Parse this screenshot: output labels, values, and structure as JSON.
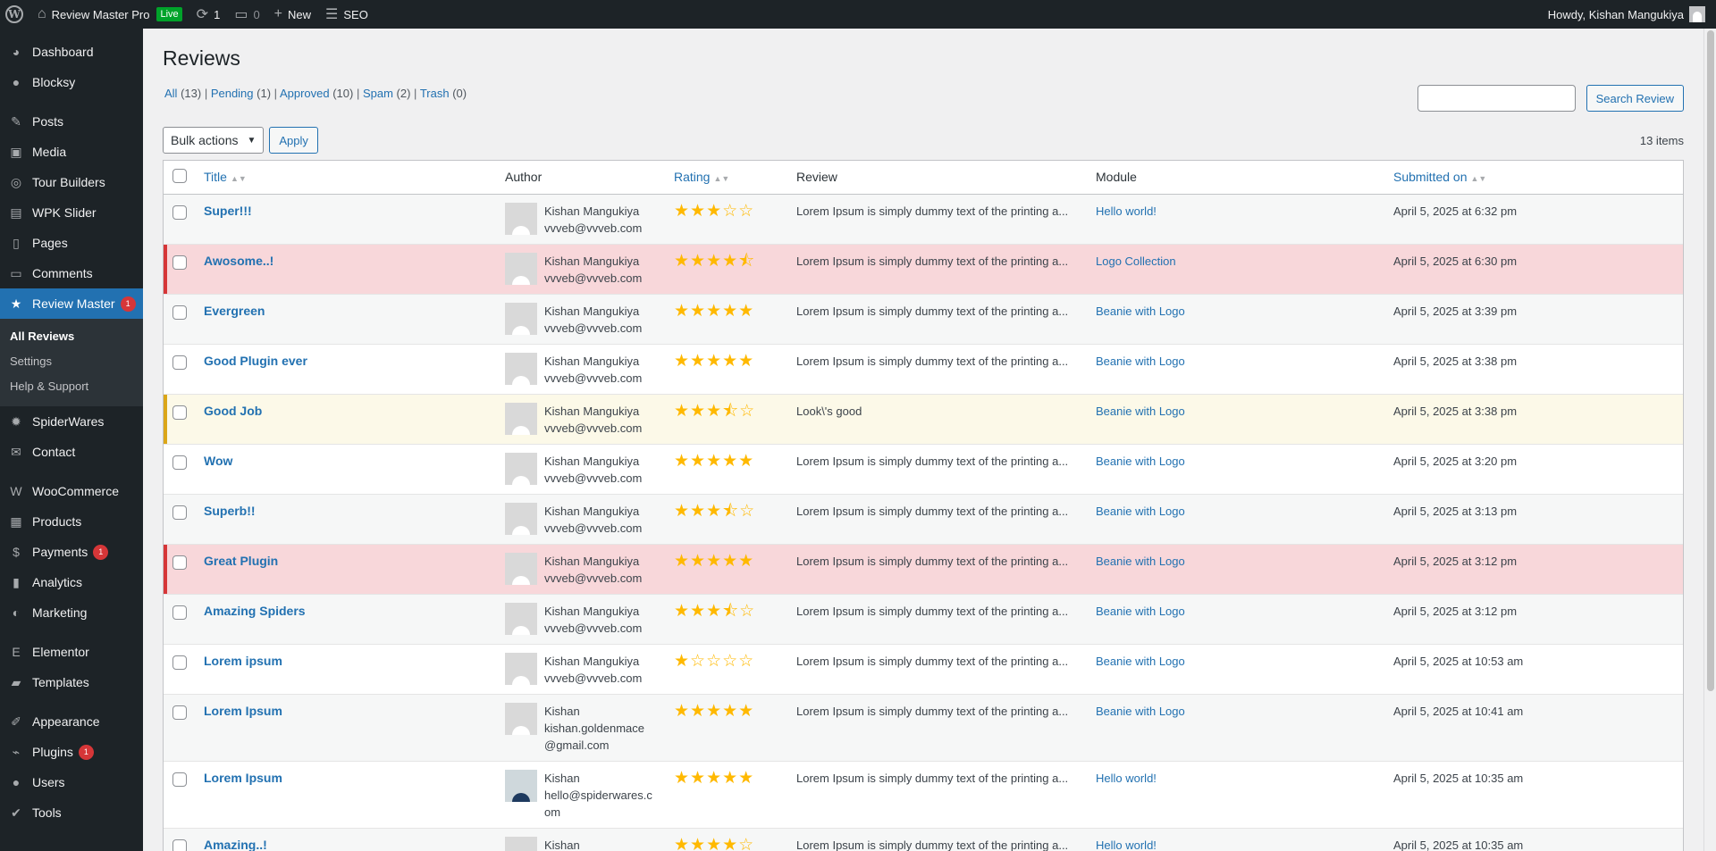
{
  "adminbar": {
    "site_name": "Review Master Pro",
    "live_badge": "Live",
    "updates_count": "1",
    "comments_count": "0",
    "new_label": "New",
    "seo_label": "SEO",
    "howdy": "Howdy, Kishan Mangukiya"
  },
  "sidebar": {
    "items": [
      {
        "label": "Dashboard",
        "icon": "dashboard-icon"
      },
      {
        "label": "Blocksy",
        "icon": "blocksy-icon"
      },
      {
        "label": "Posts",
        "icon": "pin-icon"
      },
      {
        "label": "Media",
        "icon": "media-icon"
      },
      {
        "label": "Tour Builders",
        "icon": "lightbulb-icon"
      },
      {
        "label": "WPK Slider",
        "icon": "slider-icon"
      },
      {
        "label": "Pages",
        "icon": "pages-icon"
      },
      {
        "label": "Comments",
        "icon": "comment-icon"
      },
      {
        "label": "Review Master",
        "icon": "star-icon",
        "badge": "1"
      },
      {
        "label": "SpiderWares",
        "icon": "gear-icon"
      },
      {
        "label": "Contact",
        "icon": "mail-icon"
      },
      {
        "label": "WooCommerce",
        "icon": "woo-icon"
      },
      {
        "label": "Products",
        "icon": "archive-icon"
      },
      {
        "label": "Payments",
        "icon": "dollar-icon",
        "badge": "1"
      },
      {
        "label": "Analytics",
        "icon": "chart-icon"
      },
      {
        "label": "Marketing",
        "icon": "megaphone-icon"
      },
      {
        "label": "Elementor",
        "icon": "elementor-icon"
      },
      {
        "label": "Templates",
        "icon": "folder-icon"
      },
      {
        "label": "Appearance",
        "icon": "brush-icon"
      },
      {
        "label": "Plugins",
        "icon": "plug-icon",
        "badge": "1"
      },
      {
        "label": "Users",
        "icon": "user-icon"
      },
      {
        "label": "Tools",
        "icon": "wrench-icon"
      }
    ],
    "submenu": [
      "All Reviews",
      "Settings",
      "Help & Support"
    ]
  },
  "page": {
    "title": "Reviews",
    "filters": [
      {
        "label": "All",
        "count": "(13)"
      },
      {
        "label": "Pending",
        "count": "(1)"
      },
      {
        "label": "Approved",
        "count": "(10)"
      },
      {
        "label": "Spam",
        "count": "(2)"
      },
      {
        "label": "Trash",
        "count": "(0)"
      }
    ],
    "search_button": "Search Review",
    "search_value": "",
    "bulk_actions": "Bulk actions",
    "apply": "Apply",
    "items_count": "13 items"
  },
  "table": {
    "columns": {
      "title": "Title",
      "author": "Author",
      "rating": "Rating",
      "review": "Review",
      "module": "Module",
      "submitted": "Submitted on"
    },
    "rows": [
      {
        "title": "Super!!!",
        "author": "Kishan Mangukiya",
        "email": "vvveb@vvveb.com",
        "rating": 3,
        "review": "Lorem Ipsum is simply dummy text of the printing a...",
        "module": "Hello world!",
        "date": "April 5, 2025 at 6:32 pm",
        "status": "alt"
      },
      {
        "title": "Awosome..!",
        "author": "Kishan Mangukiya",
        "email": "vvveb@vvveb.com",
        "rating": 4.5,
        "review": "Lorem Ipsum is simply dummy text of the printing a...",
        "module": "Logo Collection",
        "date": "April 5, 2025 at 6:30 pm",
        "status": "spam"
      },
      {
        "title": "Evergreen",
        "author": "Kishan Mangukiya",
        "email": "vvveb@vvveb.com",
        "rating": 5,
        "review": "Lorem Ipsum is simply dummy text of the printing a...",
        "module": "Beanie with Logo",
        "date": "April 5, 2025 at 3:39 pm",
        "status": "alt"
      },
      {
        "title": "Good Plugin ever",
        "author": "Kishan Mangukiya",
        "email": "vvveb@vvveb.com",
        "rating": 5,
        "review": "Lorem Ipsum is simply dummy text of the printing a...",
        "module": "Beanie with Logo",
        "date": "April 5, 2025 at 3:38 pm",
        "status": ""
      },
      {
        "title": "Good Job",
        "author": "Kishan Mangukiya",
        "email": "vvveb@vvveb.com",
        "rating": 3.5,
        "review": "Look\\'s good",
        "module": "Beanie with Logo",
        "date": "April 5, 2025 at 3:38 pm",
        "status": "pending"
      },
      {
        "title": "Wow",
        "author": "Kishan Mangukiya",
        "email": "vvveb@vvveb.com",
        "rating": 5,
        "review": "Lorem Ipsum is simply dummy text of the printing a...",
        "module": "Beanie with Logo",
        "date": "April 5, 2025 at 3:20 pm",
        "status": ""
      },
      {
        "title": "Superb!!",
        "author": "Kishan Mangukiya",
        "email": "vvveb@vvveb.com",
        "rating": 3.5,
        "review": "Lorem Ipsum is simply dummy text of the printing a...",
        "module": "Beanie with Logo",
        "date": "April 5, 2025 at 3:13 pm",
        "status": "alt"
      },
      {
        "title": "Great Plugin",
        "author": "Kishan Mangukiya",
        "email": "vvveb@vvveb.com",
        "rating": 5,
        "review": "Lorem Ipsum is simply dummy text of the printing a...",
        "module": "Beanie with Logo",
        "date": "April 5, 2025 at 3:12 pm",
        "status": "spam"
      },
      {
        "title": "Amazing Spiders",
        "author": "Kishan Mangukiya",
        "email": "vvveb@vvveb.com",
        "rating": 3.5,
        "review": "Lorem Ipsum is simply dummy text of the printing a...",
        "module": "Beanie with Logo",
        "date": "April 5, 2025 at 3:12 pm",
        "status": "alt"
      },
      {
        "title": "Lorem ipsum",
        "author": "Kishan Mangukiya",
        "email": "vvveb@vvveb.com",
        "rating": 1,
        "review": "Lorem Ipsum is simply dummy text of the printing a...",
        "module": "Beanie with Logo",
        "date": "April 5, 2025 at 10:53 am",
        "status": ""
      },
      {
        "title": "Lorem Ipsum",
        "author": "Kishan",
        "email": "kishan.goldenmace@gmail.com",
        "rating": 5,
        "review": "Lorem Ipsum is simply dummy text of the printing a...",
        "module": "Beanie with Logo",
        "date": "April 5, 2025 at 10:41 am",
        "status": "alt"
      },
      {
        "title": "Lorem Ipsum",
        "author": "Kishan",
        "email": "hello@spiderwares.com",
        "rating": 5,
        "review": "Lorem Ipsum is simply dummy text of the printing a...",
        "module": "Hello world!",
        "date": "April 5, 2025 at 10:35 am",
        "status": "",
        "photo": true
      },
      {
        "title": "Amazing..!",
        "author": "Kishan",
        "email": "",
        "rating": 4,
        "review": "Lorem Ipsum is simply dummy text of the printing a...",
        "module": "Hello world!",
        "date": "April 5, 2025 at 10:35 am",
        "status": "alt"
      }
    ]
  }
}
